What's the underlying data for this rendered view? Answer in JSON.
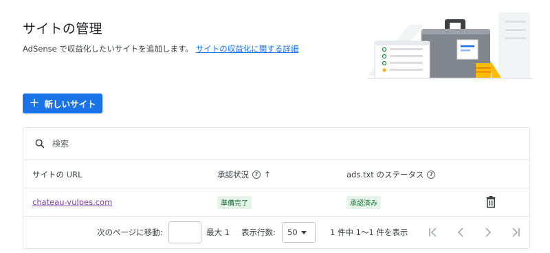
{
  "header": {
    "title": "サイトの管理",
    "description": "AdSense で収益化したいサイトを追加します。",
    "link": "サイトの収益化に関する詳細"
  },
  "actions": {
    "new_site_label": "新しいサイト",
    "new_site_icon": "plus-icon"
  },
  "table": {
    "search_placeholder": "検索",
    "columns": {
      "url": "サイトの URL",
      "approval": "承認状況",
      "ads_txt": "ads.txt のステータス"
    },
    "rows": [
      {
        "url": "chateau-vulpes.com",
        "approval": "準備完了",
        "ads_txt": "承認済み"
      }
    ]
  },
  "pagination": {
    "goto_label": "次のページに移動:",
    "goto_value": "",
    "max_label": "最大 1",
    "rows_label": "表示行数:",
    "rows_value": "50",
    "range_label": "1 件中 1～1 件を表示"
  },
  "colors": {
    "primary": "#1a73e8",
    "link": "#1a73e8",
    "visited_link": "#7e3ea9",
    "chip_bg": "#e6f4ea",
    "chip_text": "#137333"
  }
}
